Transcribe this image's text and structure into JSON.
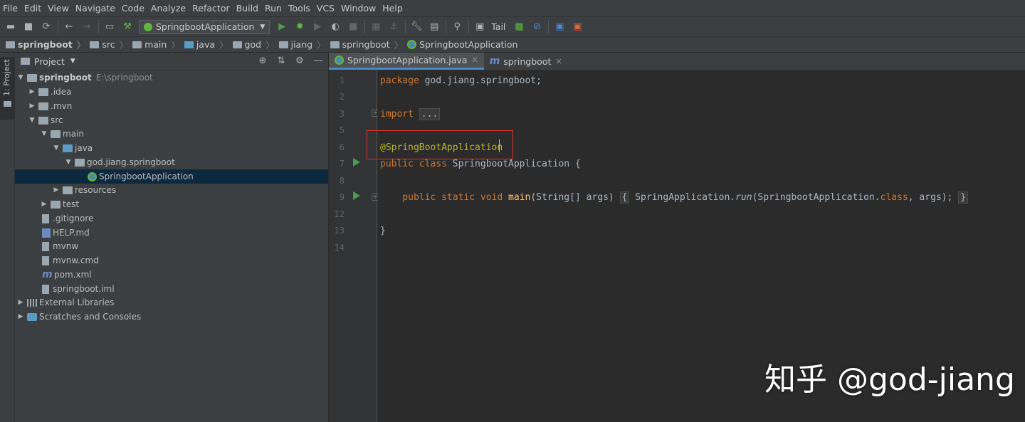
{
  "menu": [
    "File",
    "Edit",
    "View",
    "Navigate",
    "Code",
    "Analyze",
    "Refactor",
    "Build",
    "Run",
    "Tools",
    "VCS",
    "Window",
    "Help"
  ],
  "toolbar": {
    "run_config": "SpringbootApplication",
    "tail_label": "Tail"
  },
  "breadcrumb": [
    "springboot",
    "src",
    "main",
    "java",
    "god",
    "jiang",
    "springboot",
    "SpringbootApplication"
  ],
  "stripe": {
    "project_tab": "1: Project"
  },
  "project_panel": {
    "title": "Project",
    "tree": [
      {
        "label": "springboot",
        "hint": "E:\\springboot"
      },
      {
        "label": ".idea"
      },
      {
        "label": ".mvn"
      },
      {
        "label": "src"
      },
      {
        "label": "main"
      },
      {
        "label": "java"
      },
      {
        "label": "god.jiang.springboot"
      },
      {
        "label": "SpringbootApplication"
      },
      {
        "label": "resources"
      },
      {
        "label": "test"
      },
      {
        "label": ".gitignore"
      },
      {
        "label": "HELP.md"
      },
      {
        "label": "mvnw"
      },
      {
        "label": "mvnw.cmd"
      },
      {
        "label": "pom.xml"
      },
      {
        "label": "springboot.iml"
      },
      {
        "label": "External Libraries"
      },
      {
        "label": "Scratches and Consoles"
      }
    ]
  },
  "editor": {
    "tabs": [
      {
        "label": "SpringbootApplication.java"
      },
      {
        "label": "springboot"
      }
    ],
    "line_numbers": [
      "1",
      "2",
      "3",
      "5",
      "6",
      "7",
      "8",
      "9",
      "12",
      "13",
      "14"
    ],
    "code": {
      "l1_kw": "package",
      "l1_rest": " god.jiang.springboot;",
      "l3_kw": "import",
      "l3_fold": "...",
      "l6_ann": "@SpringBootApplication",
      "l7_kw": "public class",
      "l7_rest": " SpringbootApplication {",
      "l9_kw": "public static void",
      "l9_fn": "main",
      "l9_args": "(String[] args)",
      "l9_brace_open": "{",
      "l9_body1": " SpringApplication.",
      "l9_run": "run",
      "l9_body2": "(SpringbootApplication.",
      "l9_class": "class",
      "l9_body3": ", args);",
      "l9_brace_close": "}",
      "l13": "}"
    }
  },
  "watermark": "知乎 @god-jiang",
  "colors": {
    "highlight_box": "#e03333",
    "selection": "#0d293e",
    "keyword": "#cc7832",
    "annotation": "#bbb529",
    "function": "#ffc66d"
  }
}
